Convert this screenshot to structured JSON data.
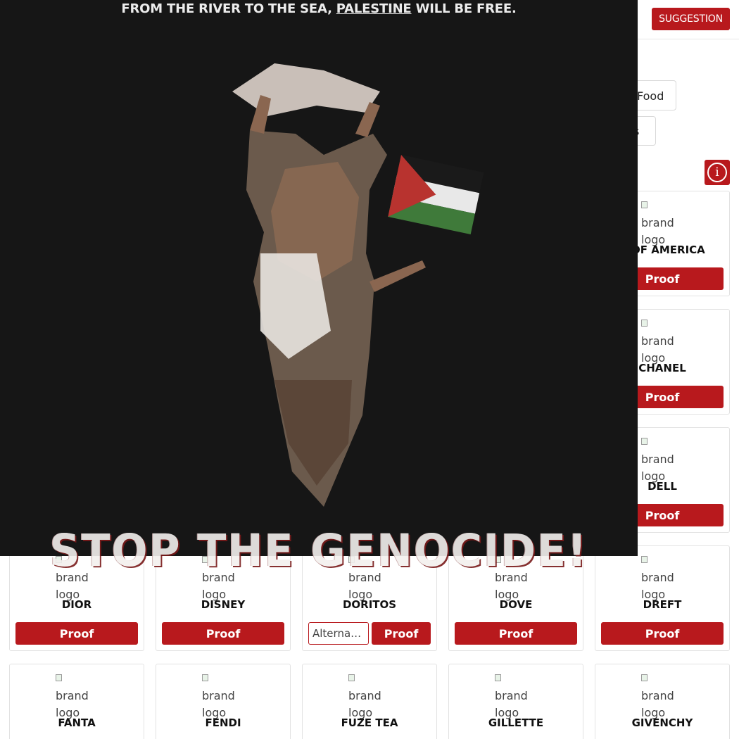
{
  "header": {
    "suggestion_label": "SUGGESTION",
    "dropdown_glyph": "⌄"
  },
  "categories": [
    {
      "label": "Food"
    },
    {
      "label": "s"
    }
  ],
  "info_label": "i",
  "brand_logo_alt": "brand logo",
  "cards": [
    {
      "name": "K OF AMERICA",
      "proof": "Proof"
    },
    {
      "name": "CHANEL",
      "proof": "Proof"
    },
    {
      "name": "DELL",
      "proof": "Proof"
    },
    {
      "name": "DIOR",
      "proof": "Proof"
    },
    {
      "name": "DISNEY",
      "proof": "Proof"
    },
    {
      "name": "DORITOS",
      "proof": "Proof",
      "alternative": "Alternat..."
    },
    {
      "name": "DOVE",
      "proof": "Proof"
    },
    {
      "name": "DREFT",
      "proof": "Proof"
    },
    {
      "name": "FANTA"
    },
    {
      "name": "FENDI"
    },
    {
      "name": "FUZE TEA"
    },
    {
      "name": "GILLETTE"
    },
    {
      "name": "GIVENCHY"
    }
  ],
  "overlay": {
    "slogan_before": "FROM THE RIVER TO THE SEA, ",
    "slogan_link": "PALESTINE",
    "slogan_after": " WILL BE FREE.",
    "headline": "STOP THE GENOCIDE!"
  },
  "colors": {
    "accent": "#b8191d",
    "overlay_bg": "#161616"
  }
}
